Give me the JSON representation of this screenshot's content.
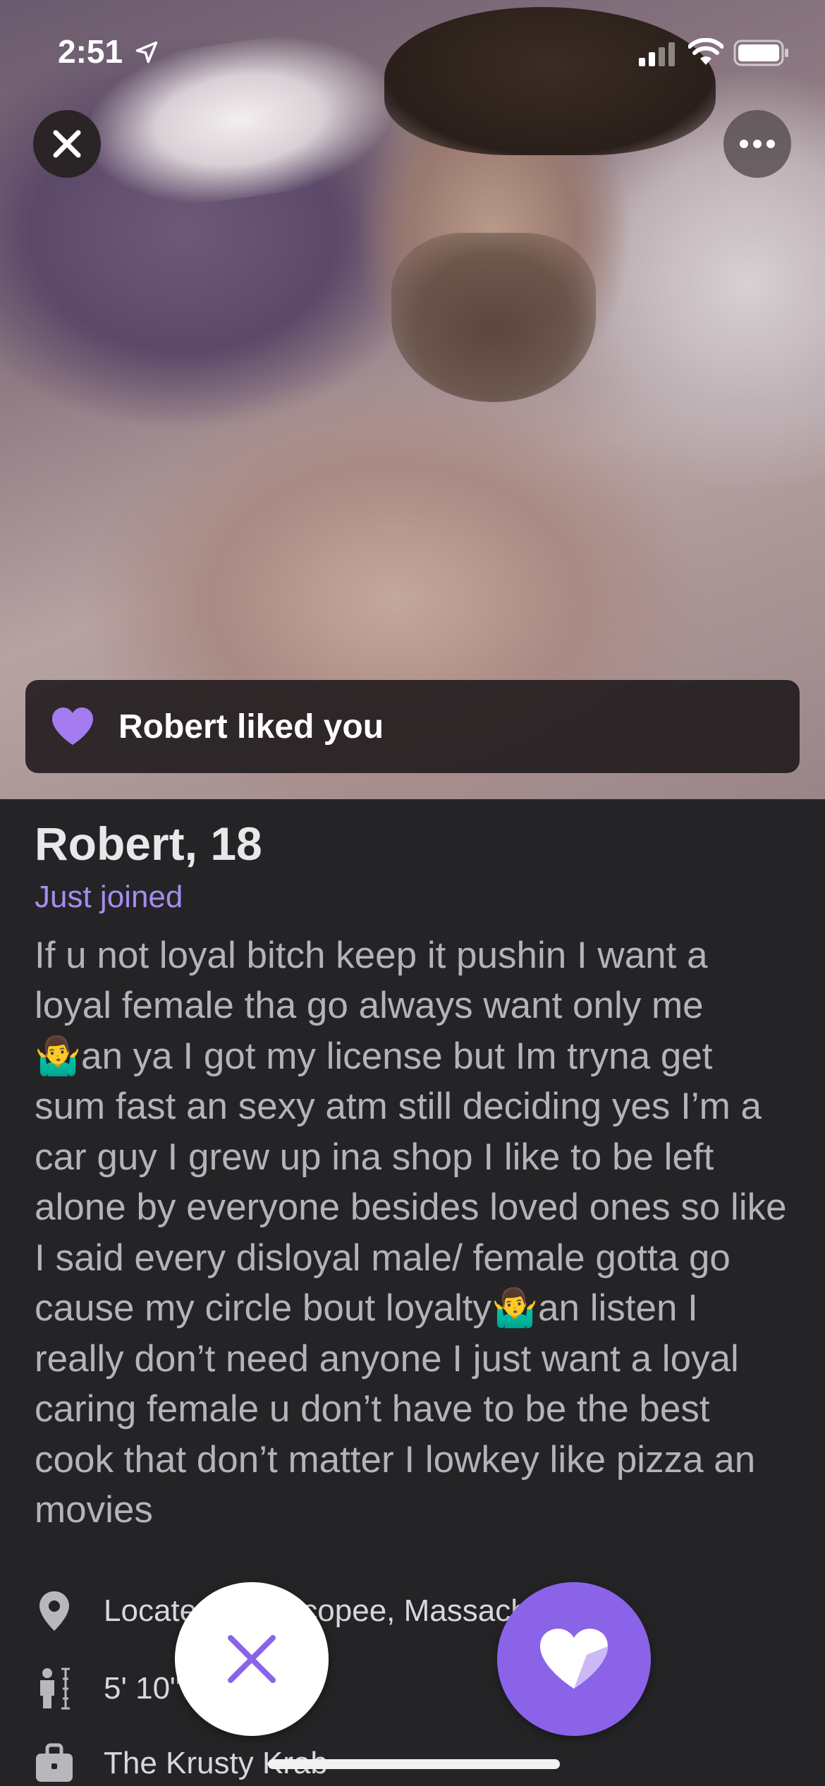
{
  "status_bar": {
    "time": "2:51",
    "icons": [
      "location-arrow-icon",
      "cellular-signal-icon",
      "wifi-icon",
      "battery-icon"
    ]
  },
  "photo": {
    "top_left_button": "close-icon",
    "top_right_button": "ellipsis-icon"
  },
  "banner": {
    "icon": "heart-icon",
    "text": "Robert liked you"
  },
  "profile": {
    "name_age": "Robert, 18",
    "status": "Just joined",
    "bio": "If u not loyal bitch keep it pushin I want a loyal female tha go always want only me 🤷‍♂️an ya I got my license but Im tryna get sum fast an sexy atm still deciding yes I’m a car guy I grew up ina shop I like to be left alone by everyone besides loved ones so like I said every disloyal male/ female gotta go cause my circle bout loyalty🤷‍♂️an listen I really don’t need anyone I just want a loyal caring female u don’t have to be the best cook that don’t matter I lowkey like pizza an movies"
  },
  "details": {
    "location": "Located in Chicopee, Massachusetts",
    "height": "5' 10\"",
    "job": "The Krusty Krab"
  },
  "actions": {
    "pass_icon": "x-icon",
    "like_icon": "heart-icon"
  },
  "colors": {
    "accent": "#8b63e9",
    "accent_text": "#a78bf0",
    "background": "#242426"
  }
}
